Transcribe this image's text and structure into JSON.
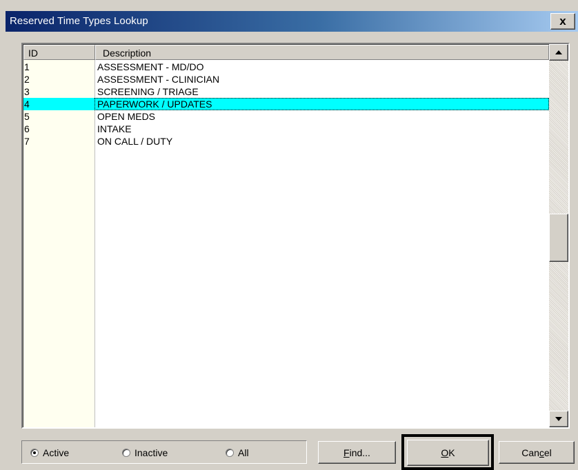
{
  "window": {
    "title": "Reserved Time Types Lookup",
    "close_label": "x"
  },
  "list": {
    "columns": [
      "ID",
      "Description"
    ],
    "rows": [
      {
        "id": "1",
        "description": "ASSESSMENT - MD/DO"
      },
      {
        "id": "2",
        "description": "ASSESSMENT - CLINICIAN"
      },
      {
        "id": "3",
        "description": "SCREENING / TRIAGE"
      },
      {
        "id": "4",
        "description": "PAPERWORK / UPDATES"
      },
      {
        "id": "5",
        "description": "OPEN MEDS"
      },
      {
        "id": "6",
        "description": "INTAKE"
      },
      {
        "id": "7",
        "description": "ON CALL / DUTY"
      }
    ],
    "selected_index": 3,
    "colors": {
      "selected_row": "#00ffff",
      "id_column": "#fffff0"
    }
  },
  "filter": {
    "options": [
      "Active",
      "Inactive",
      "All"
    ],
    "selected": "Active"
  },
  "buttons": {
    "find": {
      "mnemonic": "F",
      "rest": "ind..."
    },
    "ok": {
      "mnemonic": "O",
      "rest": "K"
    },
    "cancel": {
      "prefix": "Can",
      "mnemonic": "c",
      "rest": "el"
    }
  }
}
